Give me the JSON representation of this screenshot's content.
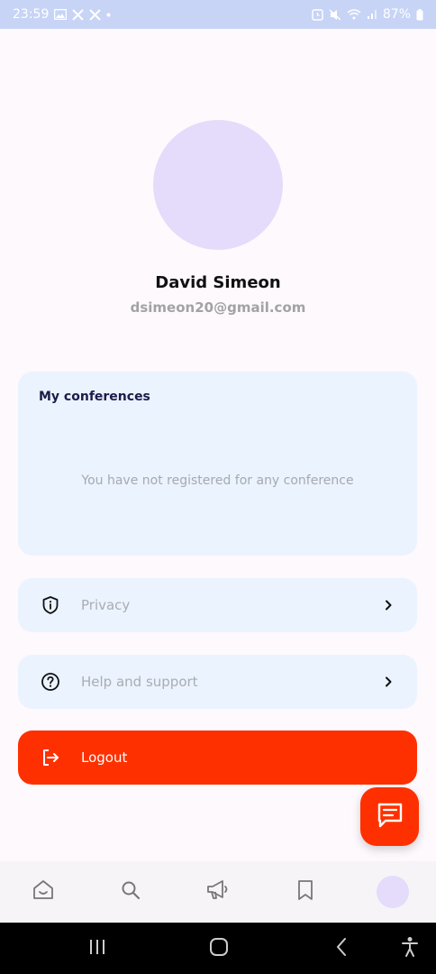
{
  "status_bar": {
    "time": "23:59",
    "battery": "87%"
  },
  "profile": {
    "name": "David Simeon",
    "email": "dsimeon20@gmail.com"
  },
  "conferences": {
    "title": "My conferences",
    "empty_text": "You have not registered for any conference"
  },
  "menu": {
    "privacy": "Privacy",
    "help": "Help and support",
    "logout": "Logout"
  },
  "icons": {
    "privacy": "shield-info-icon",
    "help": "question-circle-icon",
    "logout": "logout-icon",
    "chat": "chat-icon",
    "nav": [
      "home-icon",
      "search-icon",
      "megaphone-icon",
      "bookmark-icon",
      "profile-avatar"
    ]
  },
  "colors": {
    "accent": "#ff3000",
    "card_bg": "#ebf3fe",
    "avatar_bg": "#e4dcfa"
  }
}
